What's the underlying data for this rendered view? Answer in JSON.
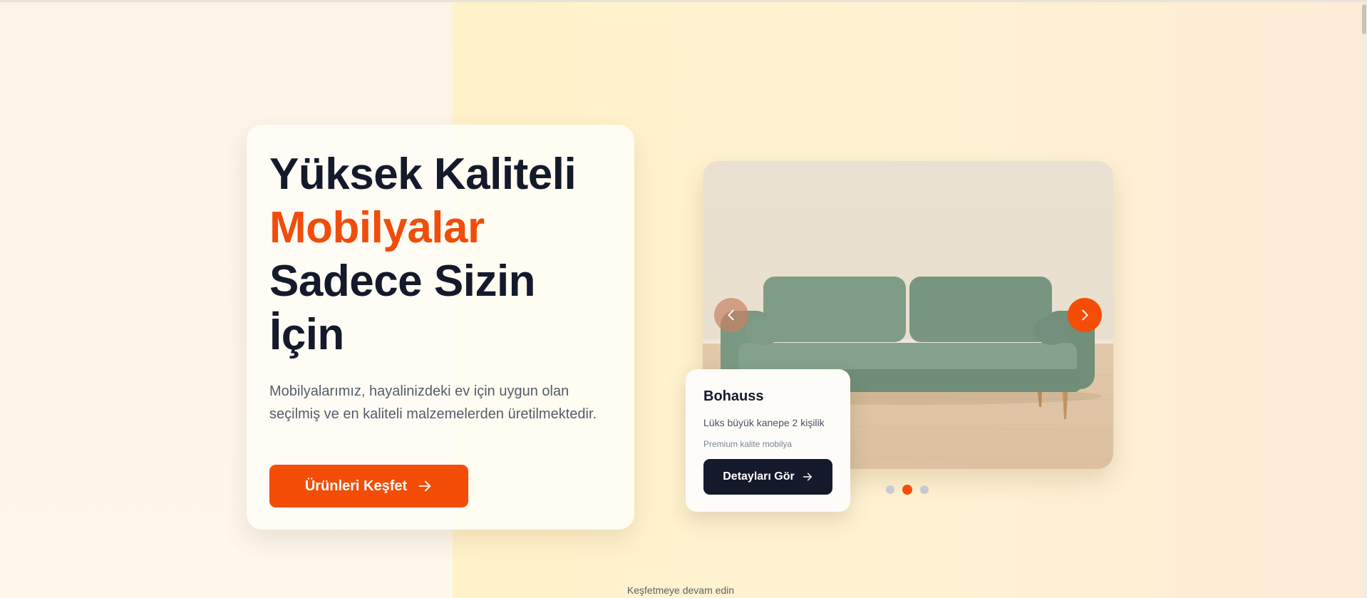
{
  "hero": {
    "title_line1": "Yüksek Kaliteli",
    "title_accent": "Mobilyalar",
    "title_line3": "Sadece Sizin",
    "title_line4": "İçin",
    "description": "Mobilyalarımız, hayalinizdeki ev için uygun olan seçilmiş ve en kaliteli malzemelerden üretilmektedir.",
    "cta_label": "Ürünleri Keşfet"
  },
  "product_card": {
    "name": "Bohauss",
    "description": "Lüks büyük kanepe 2 kişilik",
    "subtitle": "Premium kalite mobilya",
    "button_label": "Detayları Gör"
  },
  "slider": {
    "slide_count": 3,
    "active_slide": 2,
    "image_subject": "green velvet sofa"
  },
  "scroll_hint": "Keşfetmeye devam edin",
  "colors": {
    "accent": "#f34d08",
    "dark": "#141a2b",
    "text_muted": "#555c69"
  },
  "icons": {
    "cta": "arrow-right-icon",
    "slider_prev": "chevron-left-icon",
    "slider_next": "chevron-right-icon",
    "details": "arrow-right-icon"
  }
}
